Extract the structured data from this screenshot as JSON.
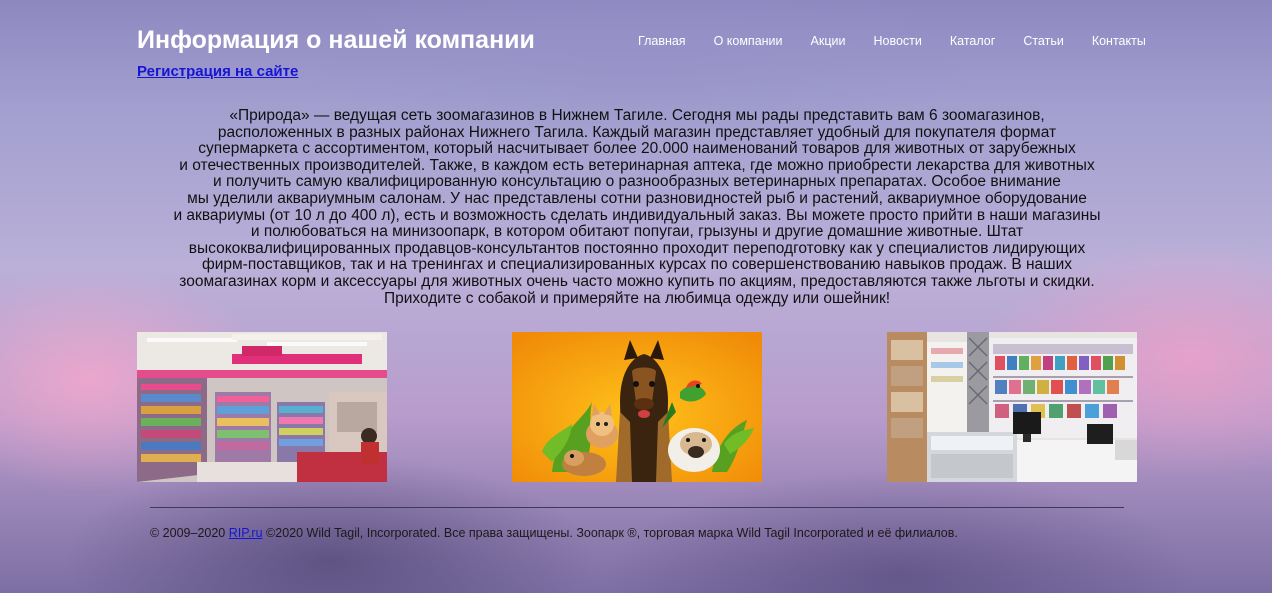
{
  "header": {
    "title": "Информация о нашей компании",
    "register_link": "Регистрация на сайте"
  },
  "nav": {
    "items": [
      {
        "label": "Главная"
      },
      {
        "label": "О компании"
      },
      {
        "label": "Акции"
      },
      {
        "label": "Новости"
      },
      {
        "label": "Каталог"
      },
      {
        "label": "Статьи"
      },
      {
        "label": "Контакты"
      }
    ]
  },
  "main": {
    "intro_lines": [
      "«Природа» — ведущая сеть зоомагазинов в Нижнем Тагиле. Сегодня мы рады представить вам 6 зоомагазинов,",
      "расположенных в разных районах Нижнего Тагила. Каждый магазин представляет удобный для покупателя формат",
      "супермаркета с ассортиментом, который насчитывает более 20.000 наименований товаров для животных от зарубежных",
      "и отечественных производителей. Также, в каждом есть ветеринарная аптека, где можно приобрести лекарства для животных",
      "и получить самую квалифицированную консультацию о разнообразных ветеринарных препаратах. Особое внимание",
      "мы уделили аквариумным салонам. У нас представлены сотни разновидностей рыб и растений, аквариумное оборудование",
      "и аквариумы (от 10 л до 400 л), есть и возможность сделать индивидуальный заказ. Вы можете просто прийти в наши магазины",
      "и полюбоваться на минизоопарк, в котором обитают попугаи, грызуны и другие домашние животные. Штат",
      "высококвалифицированных продавцов-консультантов постоянно проходит переподготовку как у специалистов лидирующих",
      "фирм-поставщиков, так и на тренингах и специализированных курсах по совершенствованию навыков продаж. В наших",
      "зоомагазинах корм и аксессуары для животных очень часто можно купить по акциям, предоставляются также льготы и скидки.",
      "Приходите с собакой и примеряйте на любимца одежду или ошейник!"
    ]
  },
  "footer": {
    "prefix": "© 2009–2020 ",
    "link": "RIP.ru",
    "suffix": " ©2020 Wild Tagil, Incorporated. Все права защищены. Зоопарк ®, торговая марка Wild Tagil Incorporated и её филиалов."
  },
  "colors": {
    "link": "#1515d6",
    "title": "#ffffff",
    "text": "#111111"
  }
}
